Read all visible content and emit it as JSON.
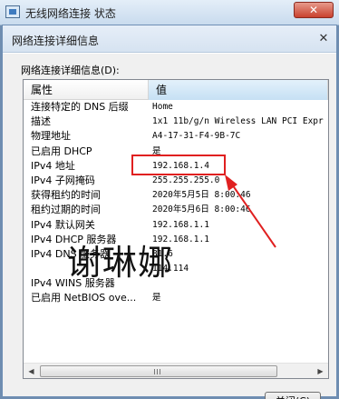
{
  "parent_window": {
    "title": "无线网络连接 状态",
    "close_glyph": "✕"
  },
  "dialog": {
    "title": "网络连接详细信息",
    "close_glyph": "✕"
  },
  "section_label": "网络连接详细信息(D):",
  "table": {
    "headers": [
      "属性",
      "值"
    ],
    "rows": [
      [
        "连接特定的 DNS 后缀",
        "Home"
      ],
      [
        "描述",
        "1x1 11b/g/n Wireless LAN PCI Expr"
      ],
      [
        "物理地址",
        "A4-17-31-F4-9B-7C"
      ],
      [
        "已启用 DHCP",
        "是"
      ],
      [
        "IPv4 地址",
        "192.168.1.4"
      ],
      [
        "IPv4 子网掩码",
        "255.255.255.0"
      ],
      [
        "获得租约的时间",
        "2020年5月5日 8:00:46"
      ],
      [
        "租约过期的时间",
        "2020年5月6日 8:00:46"
      ],
      [
        "IPv4 默认网关",
        "192.168.1.1"
      ],
      [
        "IPv4 DHCP 服务器",
        "192.168.1.1"
      ],
      [
        "IPv4 DNS 服务器",
        "81.6"
      ],
      [
        "",
        "114.114"
      ],
      [
        "IPv4 WINS 服务器",
        ""
      ],
      [
        "已启用 NetBIOS ove...",
        "是"
      ]
    ]
  },
  "scrollbar": {
    "left_arrow": "◀",
    "right_arrow": "▶"
  },
  "close_button": "关闭(C)",
  "watermark": "谢琳娜",
  "annotation_color": "#e02020"
}
